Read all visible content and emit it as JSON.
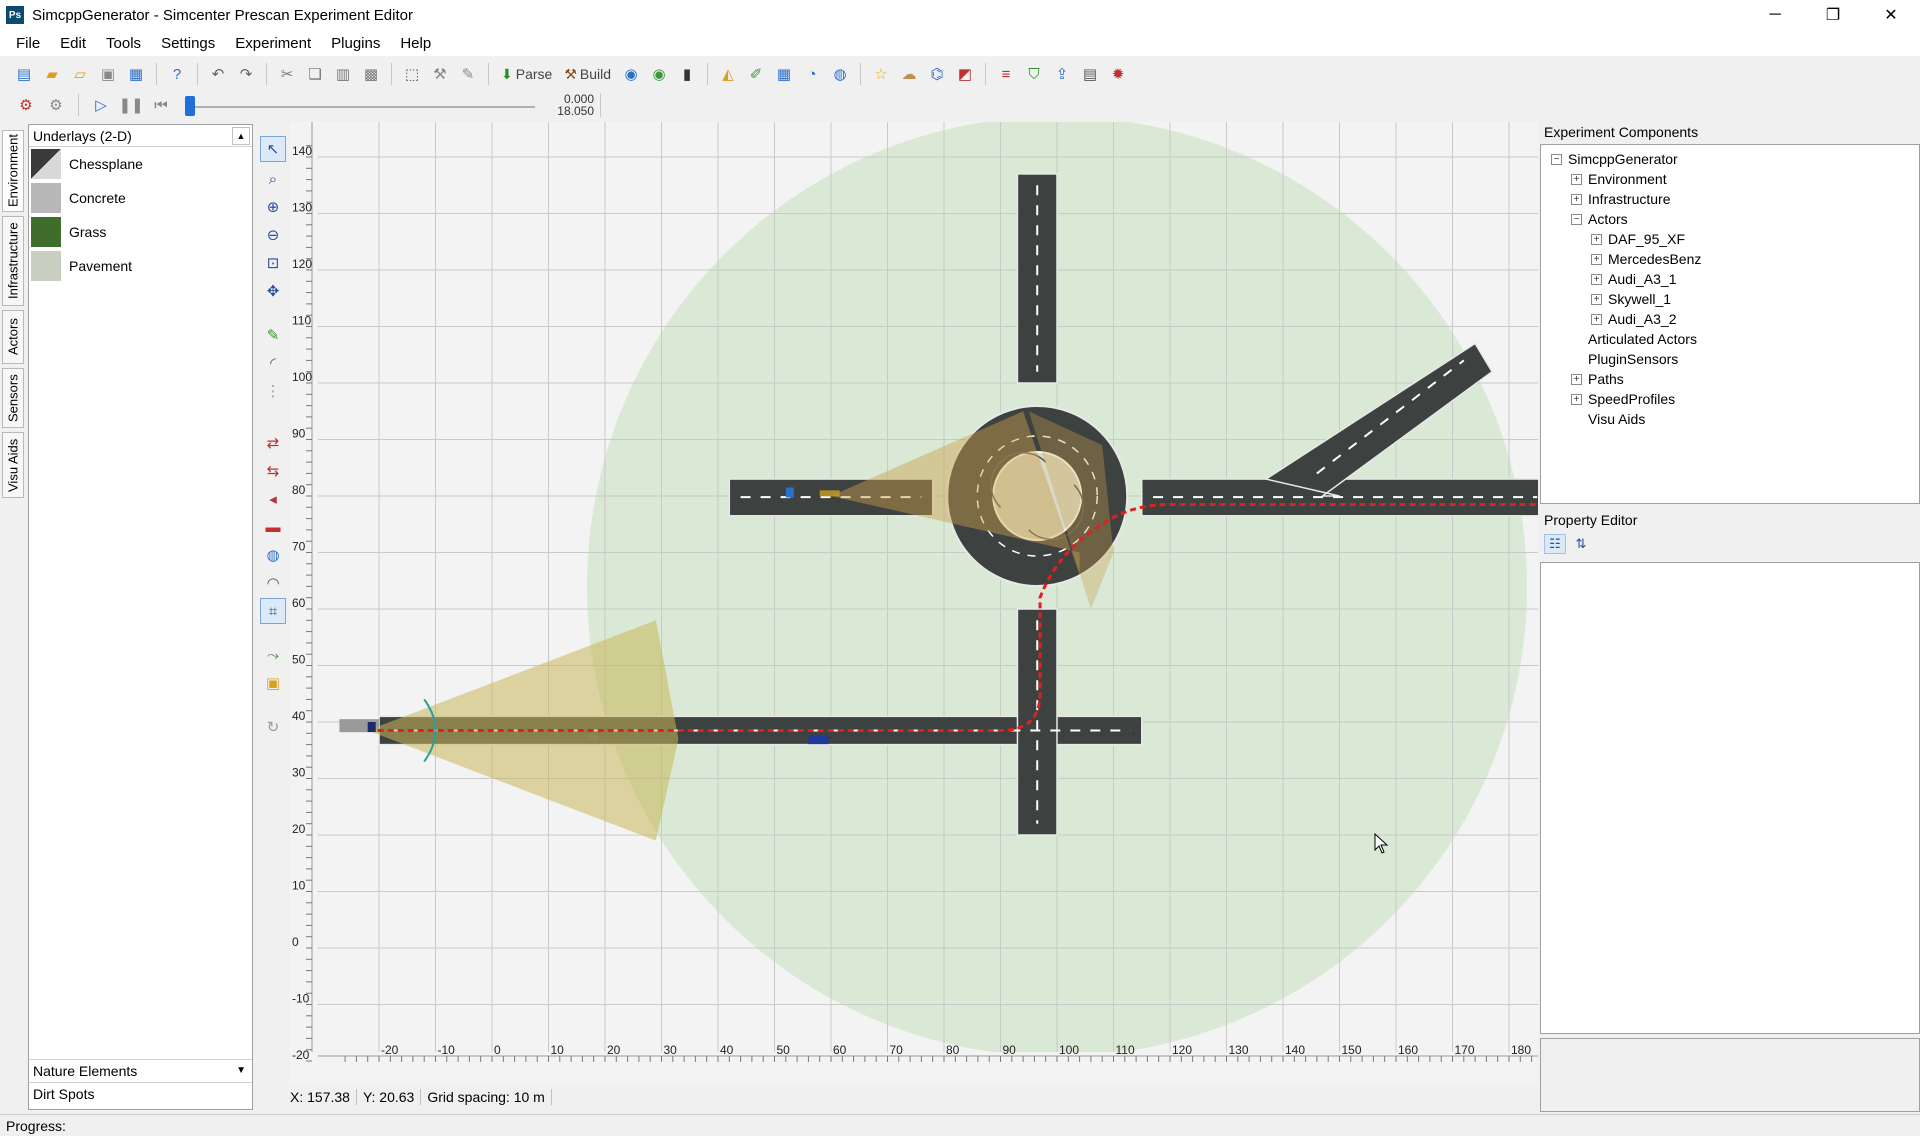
{
  "window": {
    "title": "SimcppGenerator - Simcenter Prescan Experiment Editor",
    "app_icon": "Ps",
    "minimize": "─",
    "restore": "❐",
    "close": "✕"
  },
  "menu": [
    "File",
    "Edit",
    "Tools",
    "Settings",
    "Experiment",
    "Plugins",
    "Help"
  ],
  "toolbar": {
    "parse_label": "Parse",
    "build_label": "Build"
  },
  "playback": {
    "time_current": "0.000",
    "time_total": "18.050",
    "progress": 0
  },
  "left_tabs": [
    "Environment",
    "Infrastructure",
    "Actors",
    "Sensors",
    "Visu Aids"
  ],
  "left_panel": {
    "header": "Underlays (2-D)",
    "items": [
      {
        "label": "Chessplane",
        "color": "#4a4a4a"
      },
      {
        "label": "Concrete",
        "color": "#b8b8b8"
      },
      {
        "label": "Grass",
        "color": "#3f6d2c"
      },
      {
        "label": "Pavement",
        "color": "#c9cfc0"
      }
    ],
    "bottom_header": "Nature Elements",
    "bottom_item": "Dirt Spots"
  },
  "canvas": {
    "x_ticks": [
      "-20",
      "-10",
      "0",
      "10",
      "20",
      "30",
      "40",
      "50",
      "60",
      "70",
      "80",
      "90",
      "100",
      "110",
      "120",
      "130",
      "140",
      "150",
      "160",
      "170",
      "180"
    ],
    "y_ticks": [
      "140",
      "130",
      "120",
      "110",
      "100",
      "90",
      "80",
      "70",
      "60",
      "50",
      "40",
      "30",
      "20",
      "10",
      "0",
      "-10",
      "-20"
    ]
  },
  "coords": {
    "x": "X: 157.38",
    "y": "Y: 20.63",
    "grid": "Grid spacing: 10 m"
  },
  "experiment_components": {
    "title": "Experiment Components",
    "tree": [
      {
        "label": "SimcppGenerator",
        "level": 0,
        "box": "−"
      },
      {
        "label": "Environment",
        "level": 1,
        "box": "+"
      },
      {
        "label": "Infrastructure",
        "level": 1,
        "box": "+"
      },
      {
        "label": "Actors",
        "level": 1,
        "box": "−"
      },
      {
        "label": "DAF_95_XF",
        "level": 2,
        "box": "+"
      },
      {
        "label": "MercedesBenz",
        "level": 2,
        "box": "+"
      },
      {
        "label": "Audi_A3_1",
        "level": 2,
        "box": "+"
      },
      {
        "label": "Skywell_1",
        "level": 2,
        "box": "+"
      },
      {
        "label": "Audi_A3_2",
        "level": 2,
        "box": "+"
      },
      {
        "label": "Articulated Actors",
        "level": 1,
        "box": ""
      },
      {
        "label": "PluginSensors",
        "level": 1,
        "box": ""
      },
      {
        "label": "Paths",
        "level": 1,
        "box": "+"
      },
      {
        "label": "SpeedProfiles",
        "level": 1,
        "box": "+"
      },
      {
        "label": "Visu Aids",
        "level": 1,
        "box": ""
      }
    ]
  },
  "property_editor": {
    "title": "Property Editor"
  },
  "status": {
    "progress_label": "Progress:"
  }
}
